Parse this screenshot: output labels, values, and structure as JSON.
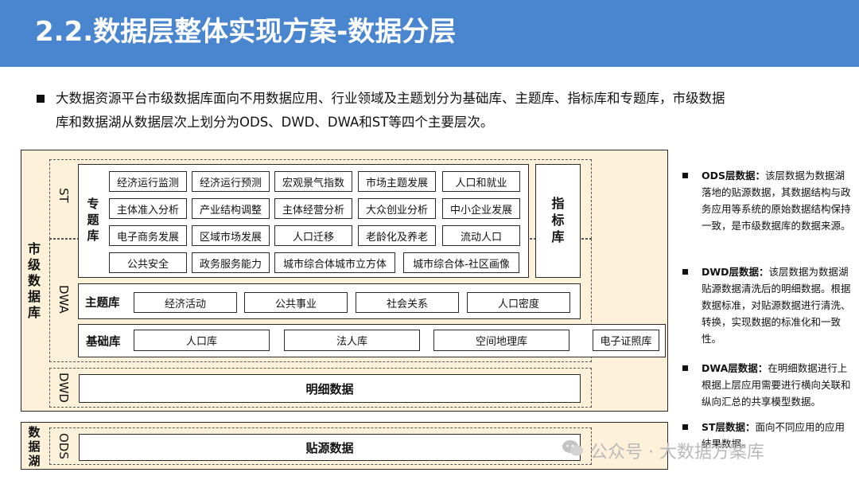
{
  "title": "2.2.数据层整体实现方案-数据分层",
  "intro": {
    "line1": "大数据资源平台市级数据库面向不用数据应用、行业领域及主题划分为基础库、主题库、指标库和专题库，市级数据",
    "line2": "库和数据湖从数据层次上划分为ODS、DWD、DWA和ST等四个主要层次。"
  },
  "diagram": {
    "city_db_label": [
      "市",
      "级",
      "数",
      "据",
      "库"
    ],
    "data_lake_label": [
      "数",
      "据",
      "湖"
    ],
    "layers": {
      "st": "ST",
      "dwa": "DWA",
      "dwd": "DWD",
      "ods": "ODS"
    },
    "topic_db_label": [
      "专",
      "题",
      "库"
    ],
    "indicator_db_label": [
      "指",
      "标",
      "库"
    ],
    "topic_cells": [
      [
        "经济运行监测",
        "经济运行预测",
        "宏观景气指数",
        "市场主题发展",
        "人口和就业"
      ],
      [
        "主体准入分析",
        "产业结构调整",
        "主体经营分析",
        "大众创业分析",
        "中小企业发展"
      ],
      [
        "电子商务发展",
        "区域市场发展",
        "人口迁移",
        "老龄化及养老",
        "流动人口"
      ],
      [
        "公共安全",
        "政务服务能力",
        "城市综合体城市立方体",
        "城市综合体-社区画像"
      ]
    ],
    "theme_db": {
      "label": "主题库",
      "items": [
        "经济活动",
        "公共事业",
        "社会关系",
        "人口密度"
      ]
    },
    "base_db": {
      "label": "基础库",
      "items": [
        "人口库",
        "法人库",
        "空间地理库",
        "电子证照库"
      ]
    },
    "detail_data": "明细数据",
    "source_data": "贴源数据"
  },
  "notes": [
    {
      "term": "ODS层数据：",
      "text": "该层数据为数据湖落地的贴源数据，其数据结构与政务应用等系统的原始数据结构保持一致，是市级数据库的数据来源。"
    },
    {
      "term": "DWD层数据：",
      "text": "该层数据为数据湖贴源数据清洗后的明细数据。根据数据标准，对贴源数据进行清洗、转换，实现数据的标准化和一致性。"
    },
    {
      "term": "DWA层数据：",
      "text": "在明细数据进行上根据上层应用需要进行横向关联和纵向汇总的共享模型数据。"
    },
    {
      "term": "ST层数据：",
      "text": "面向不同应用的应用结果数据。"
    }
  ],
  "watermark": "公众号 · 大数据方案库",
  "colors": {
    "header": "#4a86cf",
    "panel": "#fdf1da",
    "border": "#2a2a2a"
  }
}
